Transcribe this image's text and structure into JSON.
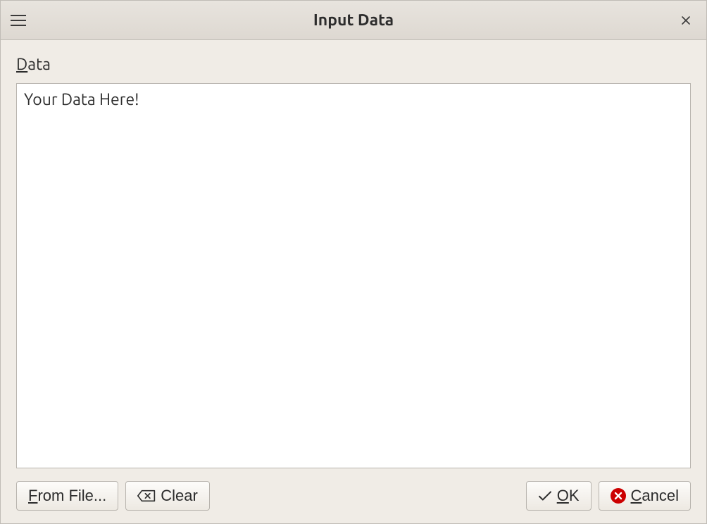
{
  "window": {
    "title": "Input Data"
  },
  "form": {
    "data_label_underline": "D",
    "data_label_rest": "ata",
    "data_value": "Your Data Here!"
  },
  "buttons": {
    "from_file_underline": "F",
    "from_file_rest": "rom File...",
    "clear": "Clear",
    "ok_underline": "O",
    "ok_rest": "K",
    "cancel_underline": "C",
    "cancel_rest": "ancel"
  }
}
